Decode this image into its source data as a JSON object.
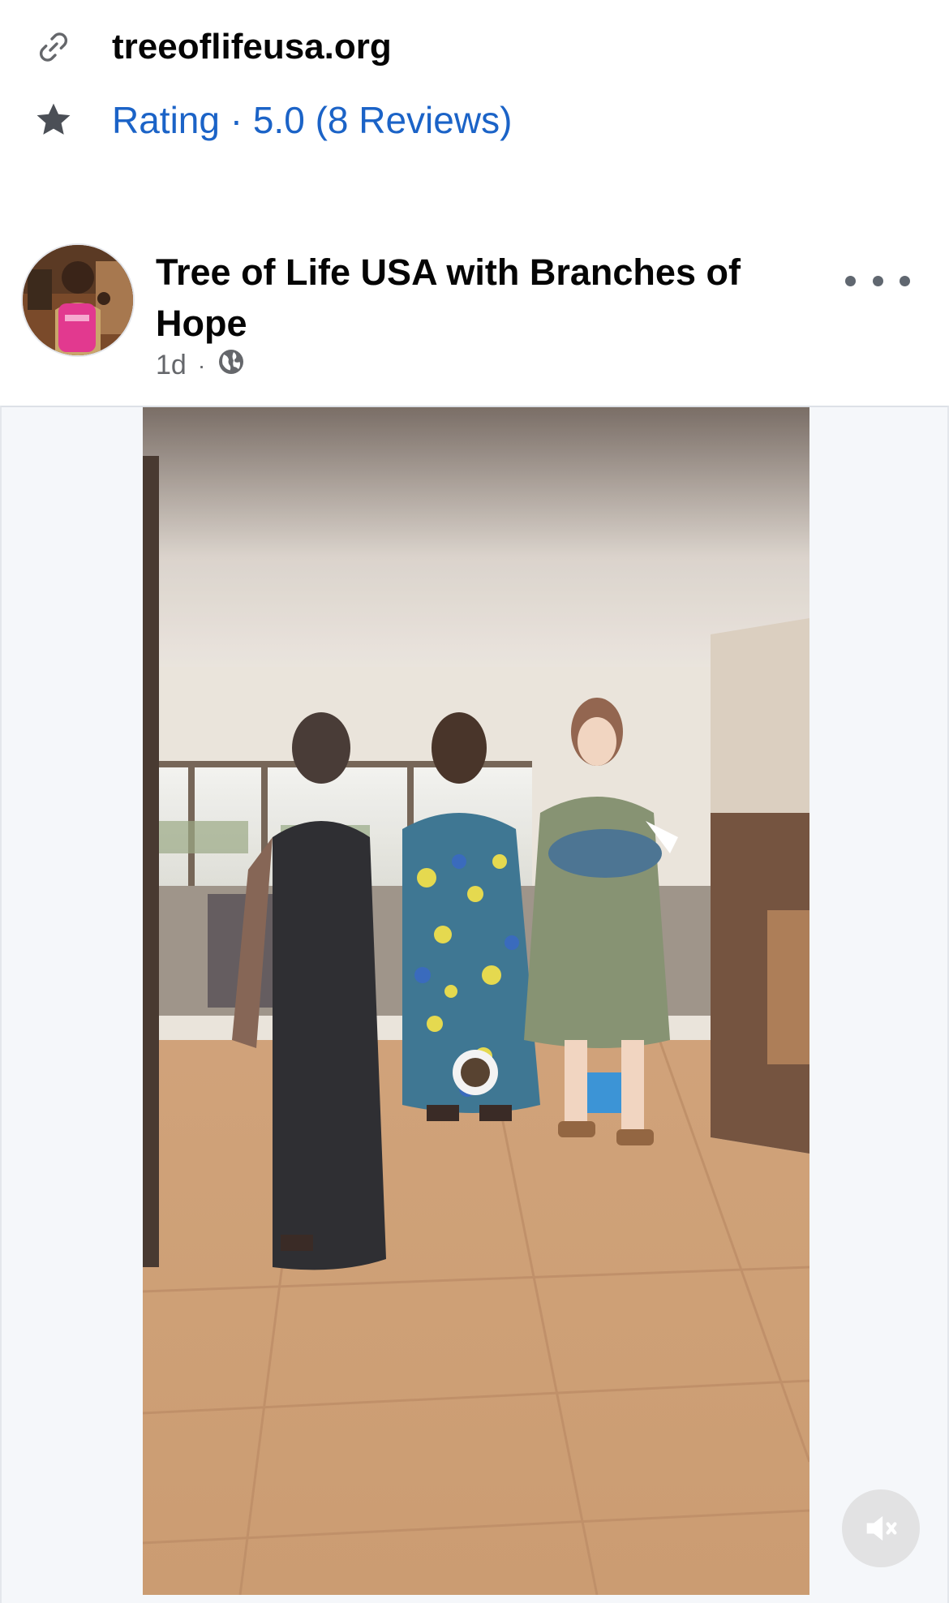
{
  "website": {
    "icon": "link-icon",
    "text": "treeoflifeusa.org"
  },
  "rating": {
    "icon": "star-icon",
    "text": "Rating · 5.0 (8 Reviews)"
  },
  "post": {
    "page_name": "Tree of Life USA with Branches of Hope",
    "time": "1d",
    "separator": "·",
    "privacy_icon": "globe-icon",
    "more_icon": "more-options-icon"
  },
  "video": {
    "mute_icon": "muted-speaker-icon"
  },
  "colors": {
    "link_blue": "#1b63c7",
    "text_primary": "#050505",
    "text_secondary": "#65676b"
  }
}
